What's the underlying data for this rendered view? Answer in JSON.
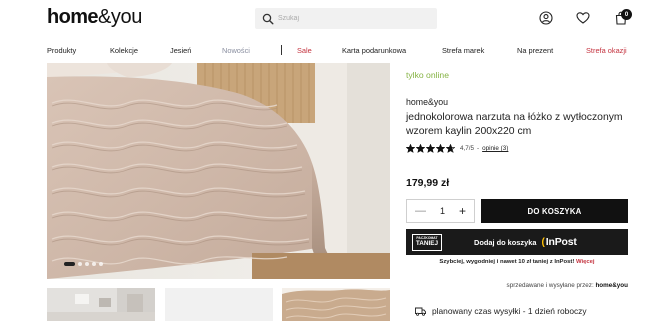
{
  "header": {
    "logo_bold": "home",
    "logo_light": "&you",
    "search_placeholder": "Szukaj",
    "cart_count": "0"
  },
  "nav": {
    "items": [
      {
        "label": "Produkty",
        "style": "normal"
      },
      {
        "label": "Kolekcje",
        "style": "normal"
      },
      {
        "label": "Jesień",
        "style": "normal"
      },
      {
        "label": "Nowości",
        "style": "muted"
      },
      {
        "label": "Sale",
        "style": "red"
      },
      {
        "label": "Karta podarunkowa",
        "style": "normal"
      },
      {
        "label": "Strefa marek",
        "style": "normal"
      },
      {
        "label": "Na prezent",
        "style": "normal"
      },
      {
        "label": "Strefa okazji",
        "style": "red"
      }
    ]
  },
  "gallery": {
    "slide_count": 5,
    "active_slide": 1
  },
  "product": {
    "availability": "tylko online",
    "brand": "home&you",
    "title": "jednokolorowa narzuta na łóżko z wytłoczonym wzorem kaylin 200x220 cm",
    "rating_value": 4.7,
    "rating_text": "4,7/5",
    "rating_separator": "-",
    "reviews_text": "opinie (3)",
    "price": "179,99 zł",
    "quantity": "1",
    "add_to_cart": "DO KOSZYKA"
  },
  "inpost": {
    "badge_top": "PACZKOMAT",
    "badge_bottom": "TANIEJ",
    "message": "Dodaj do koszyka",
    "brand_name": "InPost",
    "promo": "Szybciej, wygodniej i nawet 10 zł taniej z InPost!",
    "promo_more": "Więcej"
  },
  "seller": {
    "prefix": "sprzedawane i wysyłane przez:",
    "name": "home&you"
  },
  "shipping": {
    "text": "planowany czas wysyłki - 1 dzień roboczy"
  },
  "colors": {
    "accent_green": "#86b344",
    "sale_red": "#c4333f",
    "button_black": "#111111",
    "inpost_yellow": "#ffc107"
  }
}
